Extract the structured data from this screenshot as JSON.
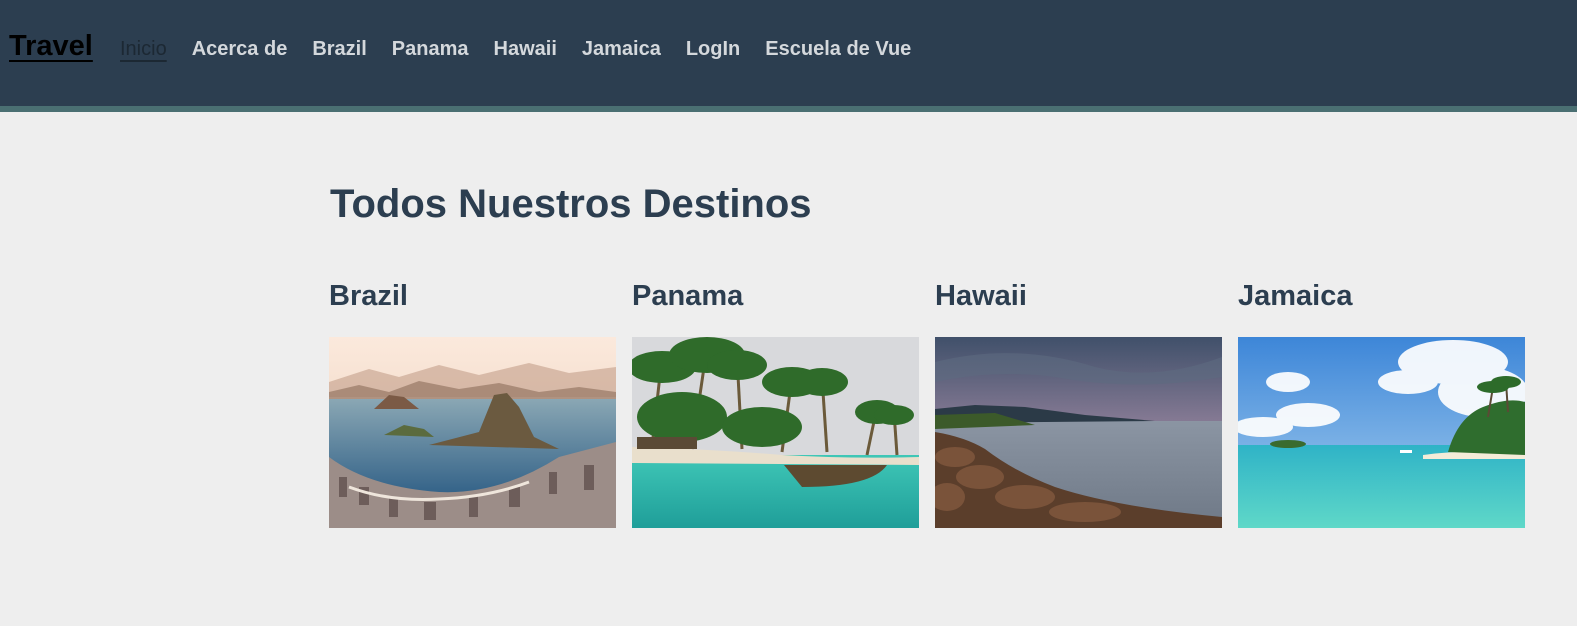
{
  "nav": {
    "brand": "Travel",
    "links": [
      {
        "label": "Inicio",
        "active": true
      },
      {
        "label": "Acerca de"
      },
      {
        "label": "Brazil"
      },
      {
        "label": "Panama"
      },
      {
        "label": "Hawaii"
      },
      {
        "label": "Jamaica"
      },
      {
        "label": "LogIn"
      },
      {
        "label": "Escuela de Vue"
      }
    ]
  },
  "main": {
    "title": "Todos Nuestros Destinos",
    "destinations": [
      {
        "name": "Brazil",
        "image": "rio-de-janeiro-bay-photo"
      },
      {
        "name": "Panama",
        "image": "palm-beach-canoe-photo"
      },
      {
        "name": "Hawaii",
        "image": "sunset-rocky-coast-photo"
      },
      {
        "name": "Jamaica",
        "image": "turquoise-lagoon-photo"
      }
    ]
  },
  "colors": {
    "navbar": "#2c3e50",
    "navbar_border": "#4a6f72",
    "background": "#eeeeee",
    "text": "#2c3e50"
  }
}
